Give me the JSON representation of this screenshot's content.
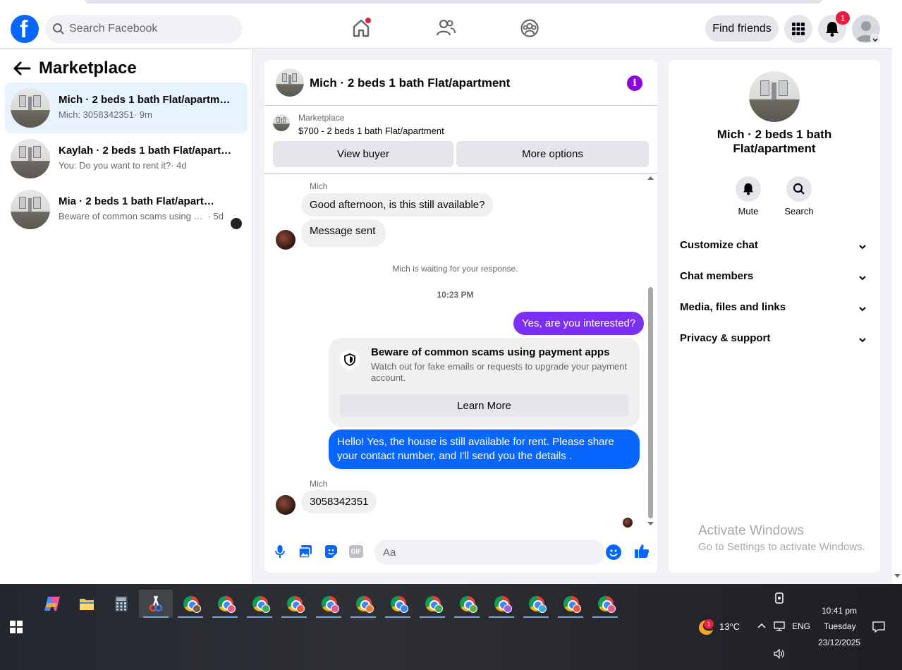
{
  "search": {
    "placeholder": "Search Facebook"
  },
  "topbar": {
    "find_friends": "Find friends",
    "notification_count": "1"
  },
  "left": {
    "title": "Marketplace",
    "conversations": [
      {
        "name": "Mich · 2 beds 1 bath Flat/apartment",
        "snippet": "Mich: 3058342351",
        "time": "· 9m"
      },
      {
        "name": "Kaylah · 2 beds 1 bath Flat/apartment",
        "snippet": "You: Do you want to rent it?",
        "time": "· 4d"
      },
      {
        "name": "Mia · 2 beds 1 bath Flat/apartment",
        "snippet": "Beware of common scams using payment apps",
        "time": " · 5d"
      }
    ]
  },
  "chat": {
    "title": "Mich · 2 beds 1 bath Flat/apartment",
    "info_glyph": "i",
    "listing": {
      "source": "Marketplace",
      "price_line": "$700 - 2 beds 1 bath Flat/apartment",
      "view_buyer": "View buyer",
      "more_options": "More options"
    },
    "messages": {
      "sender1": "Mich",
      "msg1": "Good afternoon, is this still available?",
      "msg2": "Message sent",
      "waiting": "Mich is waiting for your response.",
      "time": "10:23 PM",
      "out1": "Yes, are you interested?",
      "scam_title": "Beware of common scams using payment apps",
      "scam_desc": "Watch out for fake emails or requests to upgrade your payment account.",
      "learn_more": "Learn More",
      "out2": "Hello! Yes, the house is still available for rent. Please share your contact number, and I'll send you the details .",
      "sender2": "Mich",
      "msg3": "3058342351"
    },
    "composer": {
      "placeholder": "Aa",
      "gif_label": "GIF"
    }
  },
  "right": {
    "name": "Mich · 2 beds 1 bath Flat/apartment",
    "mute": "Mute",
    "search": "Search",
    "sections": [
      "Customize chat",
      "Chat members",
      "Media, files and links",
      "Privacy & support"
    ]
  },
  "watermark": {
    "line1": "Activate Windows",
    "line2": "Go to Settings to activate Windows."
  },
  "taskbar": {
    "temperature": "13°C",
    "weather_badge": "1",
    "language": "ENG",
    "time": "10:41 pm",
    "day": "Tuesday",
    "date": "23/12/2025"
  },
  "colors": {
    "facebook_blue": "#0866ff",
    "outgoing_purple": "#7b2ff7",
    "outgoing_blue": "#0866ff",
    "info_purple": "#8a05e1",
    "badge_red": "#e41e3f"
  }
}
